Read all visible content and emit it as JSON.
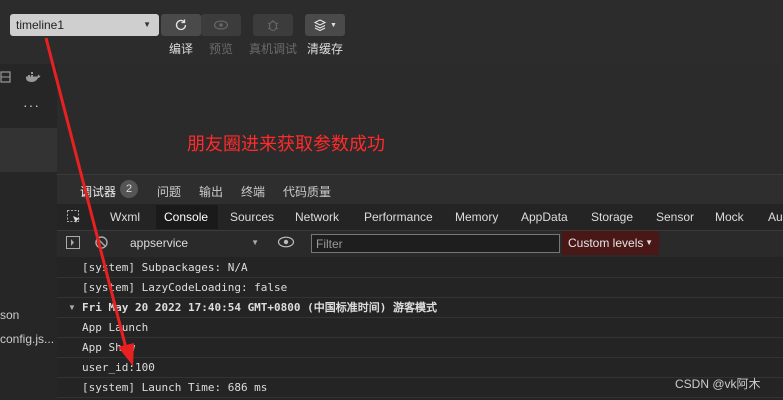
{
  "toolbar": {
    "mode_select": "timeline1",
    "compile_label": "编译",
    "preview_label": "预览",
    "device_debug_label": "真机调试",
    "clear_cache_label": "清缓存"
  },
  "left": {
    "more": "···",
    "file1": "son",
    "file2": "config.js..."
  },
  "annotation": {
    "message": "朋友圈进来获取参数成功",
    "color": "#ff2a2a"
  },
  "devtools": {
    "tabs": [
      "调试器",
      "问题",
      "输出",
      "终端",
      "代码质量"
    ],
    "debugger_badge": "2",
    "panel_tabs": [
      "Wxml",
      "Console",
      "Sources",
      "Network",
      "Performance",
      "Memory",
      "AppData",
      "Storage",
      "Sensor",
      "Mock",
      "Au"
    ],
    "active_panel": "Console",
    "context": "appservice",
    "filter_placeholder": "Filter",
    "levels": "Custom levels"
  },
  "console_lines": [
    "[system] Subpackages: N/A",
    "[system] LazyCodeLoading: false",
    "Fri May 20 2022 17:40:54 GMT+0800 (中国标准时间) 游客模式",
    "App Launch",
    "App Show",
    "user_id:100",
    "[system] Launch Time: 686 ms"
  ],
  "watermark": "CSDN @vk阿木"
}
